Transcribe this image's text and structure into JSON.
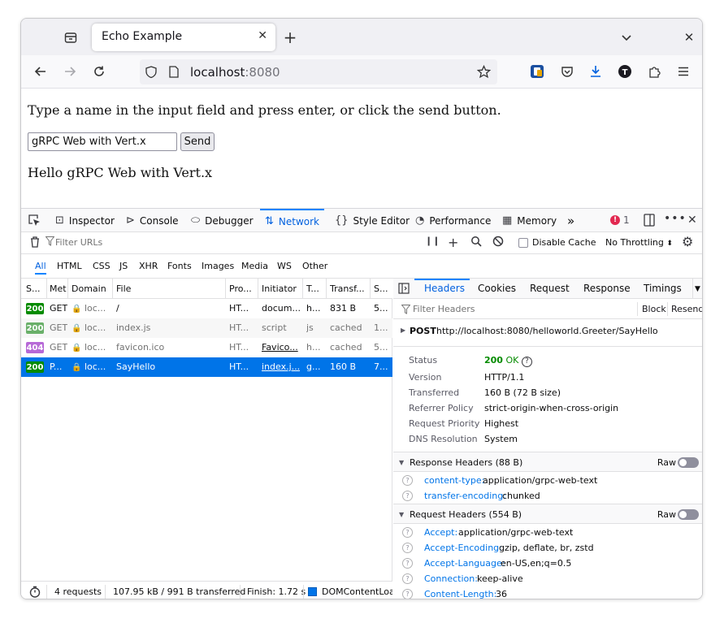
{
  "browser": {
    "tab_title": "Echo Example",
    "url_host": "localhost",
    "url_port": ":8080"
  },
  "page": {
    "prompt": "Type a name in the input field and press enter, or click the send button.",
    "input_value": "gRPC Web with Vert.x",
    "send_label": "Send",
    "reply": "Hello gRPC Web with Vert.x"
  },
  "devtools": {
    "tabs": [
      "Inspector",
      "Console",
      "Debugger",
      "Network",
      "Style Editor",
      "Performance",
      "Memory"
    ],
    "active_tab": "Network",
    "error_count": "1",
    "filter_placeholder": "Filter URLs",
    "disable_cache": "Disable Cache",
    "throttling": "No Throttling",
    "type_filters": [
      "All",
      "HTML",
      "CSS",
      "JS",
      "XHR",
      "Fonts",
      "Images",
      "Media",
      "WS",
      "Other"
    ],
    "columns": [
      "S...",
      "Met",
      "Domain",
      "File",
      "Pro...",
      "Initiator",
      "T...",
      "Transf...",
      "S..."
    ],
    "requests": [
      {
        "status": "200",
        "method": "GET",
        "domain": "loc...",
        "file": "/",
        "protocol": "HT...",
        "initiator": "docum...",
        "type": "h...",
        "transferred": "831 B",
        "size": "5..."
      },
      {
        "status": "200",
        "method": "GET",
        "domain": "loc...",
        "file": "index.js",
        "protocol": "HT...",
        "initiator": "script",
        "type": "js",
        "transferred": "cached",
        "size": "1..."
      },
      {
        "status": "404",
        "method": "GET",
        "domain": "loc...",
        "file": "favicon.ico",
        "protocol": "HT...",
        "initiator": "Favico...",
        "type": "h...",
        "transferred": "cached",
        "size": "5..."
      },
      {
        "status": "200",
        "method": "P...",
        "domain": "loc...",
        "file": "SayHello",
        "protocol": "HT...",
        "initiator": "index.j...",
        "type": "g...",
        "transferred": "160 B",
        "size": "7..."
      }
    ],
    "summary": {
      "requests": "4 requests",
      "transferred": "107.95 kB / 991 B transferred",
      "finish": "Finish: 1.72 s",
      "dom": "DOMContentLoad"
    },
    "side_tabs": [
      "Headers",
      "Cookies",
      "Request",
      "Response",
      "Timings"
    ],
    "filter_headers": "Filter Headers",
    "block": "Block",
    "resend": "Resend",
    "request_method": "POST",
    "request_url": "http://localhost:8080/helloworld.Greeter/SayHello",
    "details": [
      {
        "key": "Status",
        "value": "OK",
        "code": "200"
      },
      {
        "key": "Version",
        "value": "HTTP/1.1"
      },
      {
        "key": "Transferred",
        "value": "160 B (72 B size)"
      },
      {
        "key": "Referrer Policy",
        "value": "strict-origin-when-cross-origin"
      },
      {
        "key": "Request Priority",
        "value": "Highest"
      },
      {
        "key": "DNS Resolution",
        "value": "System"
      }
    ],
    "response_headers_title": "Response Headers (88 B)",
    "response_headers": [
      {
        "name": "content-type:",
        "value": "application/grpc-web-text"
      },
      {
        "name": "transfer-encoding:",
        "value": "chunked"
      }
    ],
    "request_headers_title": "Request Headers (554 B)",
    "request_headers": [
      {
        "name": "Accept:",
        "value": "application/grpc-web-text"
      },
      {
        "name": "Accept-Encoding:",
        "value": "gzip, deflate, br, zstd"
      },
      {
        "name": "Accept-Language:",
        "value": "en-US,en;q=0.5"
      },
      {
        "name": "Connection:",
        "value": "keep-alive"
      },
      {
        "name": "Content-Length:",
        "value": "36"
      }
    ],
    "raw_label": "Raw"
  }
}
